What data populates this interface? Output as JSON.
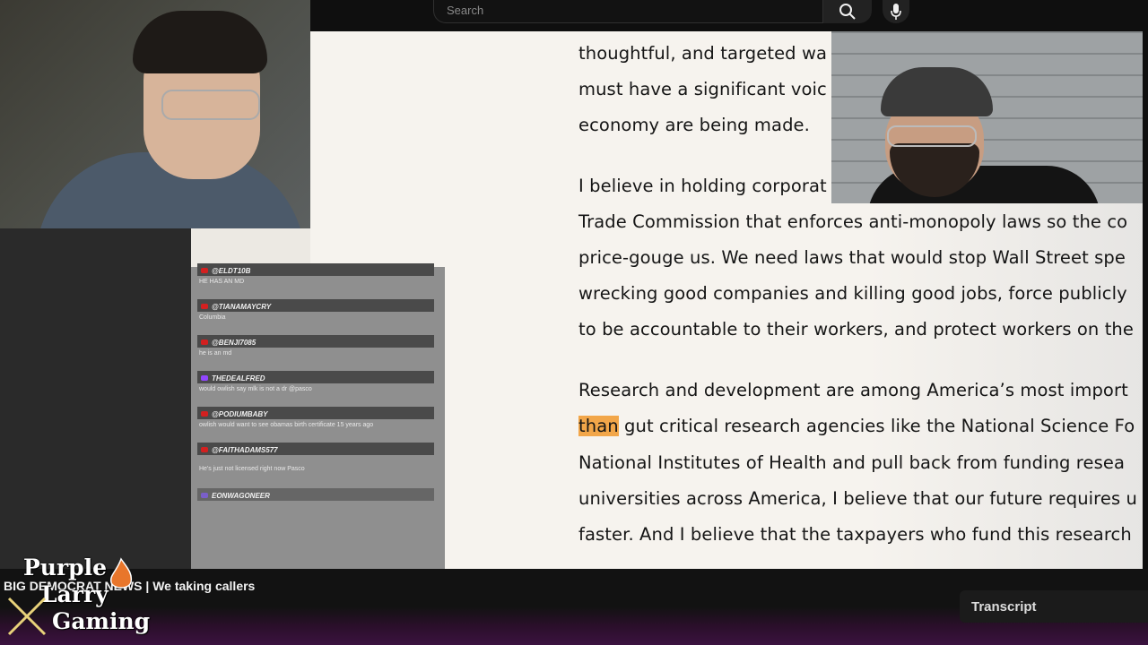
{
  "search": {
    "placeholder": "Search"
  },
  "document": {
    "lines": [
      "thoughtful, and targeted wa",
      "must have a significant voic",
      "economy are being made.",
      "I believe in holding corporat",
      "Trade Commission that enforces anti-monopoly laws so the co",
      "price-gouge us. We need laws that would stop Wall Street spe",
      "wrecking good companies and killing good jobs, force publicly",
      "to be accountable to their workers, and protect workers on the",
      "Research and development are among America’s most import",
      "than",
      "gut critical research agencies like the National Science Fo",
      "National Institutes of Health and pull back from funding resea",
      "universities across America, I believe that our future requires u",
      "faster. And I believe that the taxpayers who fund this research"
    ]
  },
  "chat": {
    "messages": [
      {
        "user": "@ELDT10B",
        "text": "HE HAS AN MD"
      },
      {
        "user": "@TIANAMAYCRY",
        "text": "Columbia"
      },
      {
        "user": "@BENJI7085",
        "text": "he is an md"
      },
      {
        "user": "THEDEALFRED",
        "text": "would owlish say mlk is not a dr @pasco"
      },
      {
        "user": "@PODIUMBABY",
        "text": "owlish would want to see obamas birth certificate 15 years ago"
      },
      {
        "user": "@FAITHADAMS577",
        "text": "He's just not licensed right now Pasco"
      },
      {
        "user": "EONWAGONEER",
        "text": ""
      }
    ]
  },
  "ticker": {
    "text": "BIG DEMOCRAT NEWS | We taking callers"
  },
  "logo": {
    "line1": "Purple",
    "line2": "Larry",
    "line3": "Gaming"
  },
  "transcript": {
    "label": "Transcript"
  },
  "colors": {
    "highlight": "#f2a649",
    "youtube_red": "#d32020",
    "doc_background": "#f6f3ee"
  }
}
